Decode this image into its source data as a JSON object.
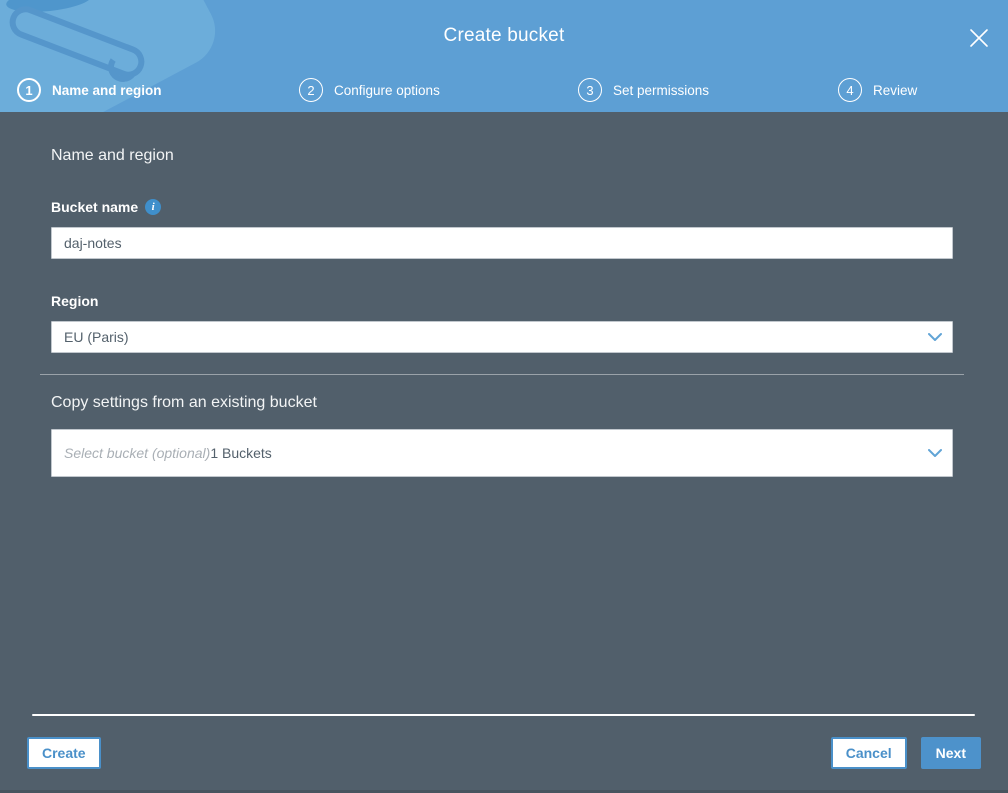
{
  "header": {
    "title": "Create bucket",
    "steps": [
      {
        "number": "1",
        "label": "Name and region"
      },
      {
        "number": "2",
        "label": "Configure options"
      },
      {
        "number": "3",
        "label": "Set permissions"
      },
      {
        "number": "4",
        "label": "Review"
      }
    ]
  },
  "form": {
    "section_title": "Name and region",
    "bucket_name": {
      "label": "Bucket name",
      "info_icon": "i",
      "value": "daj-notes"
    },
    "region": {
      "label": "Region",
      "selected": "EU (Paris)"
    },
    "copy_settings": {
      "title": "Copy settings from an existing bucket",
      "placeholder": "Select bucket (optional)",
      "bucket_count": "1 Buckets"
    }
  },
  "footer": {
    "create_label": "Create",
    "cancel_label": "Cancel",
    "next_label": "Next"
  },
  "colors": {
    "header_blue": "#5d9fd4",
    "body_slate": "#515f6b",
    "accent_blue": "#4a90c9",
    "info_blue": "#3f8fcb"
  }
}
